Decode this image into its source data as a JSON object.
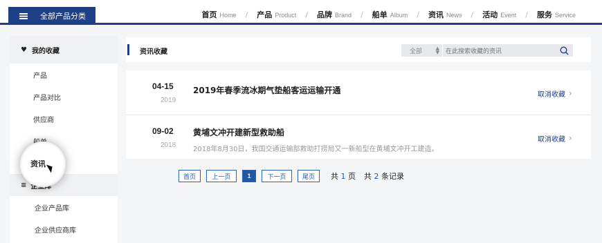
{
  "header": {
    "category_button": "全部产品分类",
    "nav": [
      {
        "zh": "首页",
        "en": "Home"
      },
      {
        "zh": "产品",
        "en": "Product"
      },
      {
        "zh": "品牌",
        "en": "Brand"
      },
      {
        "zh": "船单",
        "en": "Album"
      },
      {
        "zh": "资讯",
        "en": "News"
      },
      {
        "zh": "活动",
        "en": "Event"
      },
      {
        "zh": "服务",
        "en": "Service"
      }
    ],
    "separator": "/"
  },
  "sidebar": {
    "favorites_title": "我的收藏",
    "favorites": [
      "产品",
      "产品对比",
      "供应商",
      "船单",
      "资讯"
    ],
    "library_title": "企业库",
    "library": [
      "企业产品库",
      "企业供应商库"
    ],
    "highlighted": "资讯"
  },
  "main": {
    "title": "资讯收藏",
    "search": {
      "scope": "全部",
      "placeholder": "在此搜索收藏的资讯"
    },
    "items": [
      {
        "date": "04-15",
        "year": "2019",
        "title": "2019年春季流冰期气垫船客运运输开通",
        "desc": "",
        "action": "取消收藏"
      },
      {
        "date": "09-02",
        "year": "2018",
        "title": "黄埔文冲开建新型救助船",
        "desc": "2018年8月30日，我国交通运输部救助打捞局又一新船型在黄埔文冲开工建造。",
        "action": "取消收藏"
      }
    ]
  },
  "pager": {
    "first": "首页",
    "prev": "上一页",
    "current": "1",
    "next": "下一页",
    "last": "尾页",
    "total_prefix": "共",
    "total_pages": "1",
    "pages_suffix": "页",
    "records_prefix": "共",
    "total_records": "2",
    "records_suffix": "条记录"
  },
  "colors": {
    "brand": "#1f3f86",
    "link": "#1f5aa6"
  },
  "icons": {
    "menu": "hamburger-icon",
    "favorites": "heart-icon",
    "library": "list-icon",
    "search": "search-icon",
    "row_arrow": "chevron-right-icon"
  }
}
